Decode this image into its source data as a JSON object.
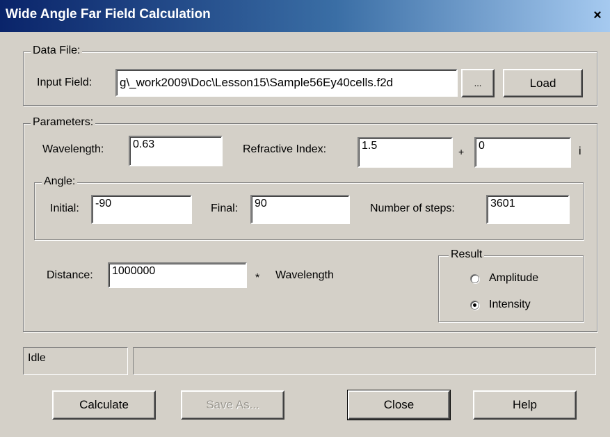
{
  "window": {
    "title": "Wide Angle Far Field Calculation",
    "close_glyph": "×"
  },
  "data_file": {
    "group_label": "Data File:",
    "input_field_label": "Input Field:",
    "input_field_value": "g\\_work2009\\Doc\\Lesson15\\Sample56Ey40cells.f2d",
    "browse_label": "...",
    "load_label": "Load"
  },
  "parameters": {
    "group_label": "Parameters:",
    "wavelength_label": "Wavelength:",
    "wavelength_value": "0.63",
    "refractive_index_label": "Refractive Index:",
    "refractive_real_value": "1.5",
    "plus_sign": "+",
    "refractive_imag_value": "0",
    "imag_unit": "i",
    "angle": {
      "group_label": "Angle:",
      "initial_label": "Initial:",
      "initial_value": "-90",
      "final_label": "Final:",
      "final_value": "90",
      "steps_label": "Number of steps:",
      "steps_value": "3601"
    },
    "distance_label": "Distance:",
    "distance_value": "1000000",
    "multiply_sign": "*",
    "distance_unit": "Wavelength",
    "result": {
      "group_label": "Result",
      "options": [
        {
          "label": "Amplitude",
          "selected": false
        },
        {
          "label": "Intensity",
          "selected": true
        }
      ]
    }
  },
  "status": {
    "text": "Idle",
    "detail": ""
  },
  "buttons": {
    "calculate": "Calculate",
    "save_as": "Save As...",
    "close": "Close",
    "help": "Help"
  }
}
